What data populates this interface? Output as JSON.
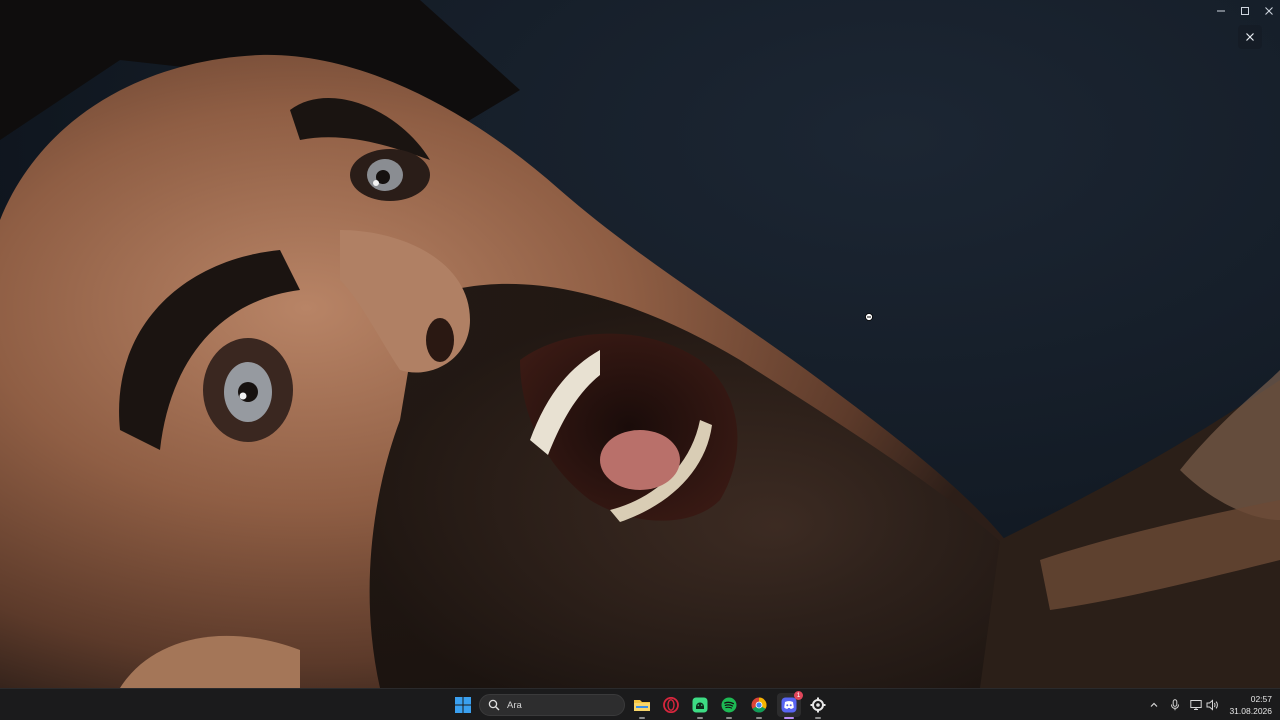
{
  "window": {
    "controls": {
      "minimize": "minimize-icon",
      "maximize": "maximize-icon",
      "close": "close-icon"
    },
    "viewer_close": "close-icon"
  },
  "taskbar": {
    "search": {
      "placeholder": "Ara",
      "icon": "search-icon"
    },
    "apps": [
      {
        "name": "Start",
        "icon": "windows-logo-icon"
      },
      {
        "name": "File Explorer",
        "icon": "folder-icon",
        "color": "#f4c542"
      },
      {
        "name": "Opera",
        "icon": "opera-icon",
        "color": "#d7263d"
      },
      {
        "name": "Android app",
        "icon": "android-icon",
        "color": "#3ddc84"
      },
      {
        "name": "Spotify",
        "icon": "spotify-icon",
        "color": "#1db954"
      },
      {
        "name": "Chrome",
        "icon": "chrome-icon"
      },
      {
        "name": "Discord",
        "icon": "discord-icon",
        "color": "#5865f2",
        "badge": "1"
      },
      {
        "name": "Settings",
        "icon": "gear-icon"
      }
    ],
    "tray": {
      "overflow_icon": "chevron-up-icon",
      "mic_icon": "microphone-icon",
      "network_icon": "network-icon",
      "volume_icon": "speaker-icon"
    },
    "clock": {
      "time": "02:57",
      "date": "31.08.2026"
    }
  }
}
